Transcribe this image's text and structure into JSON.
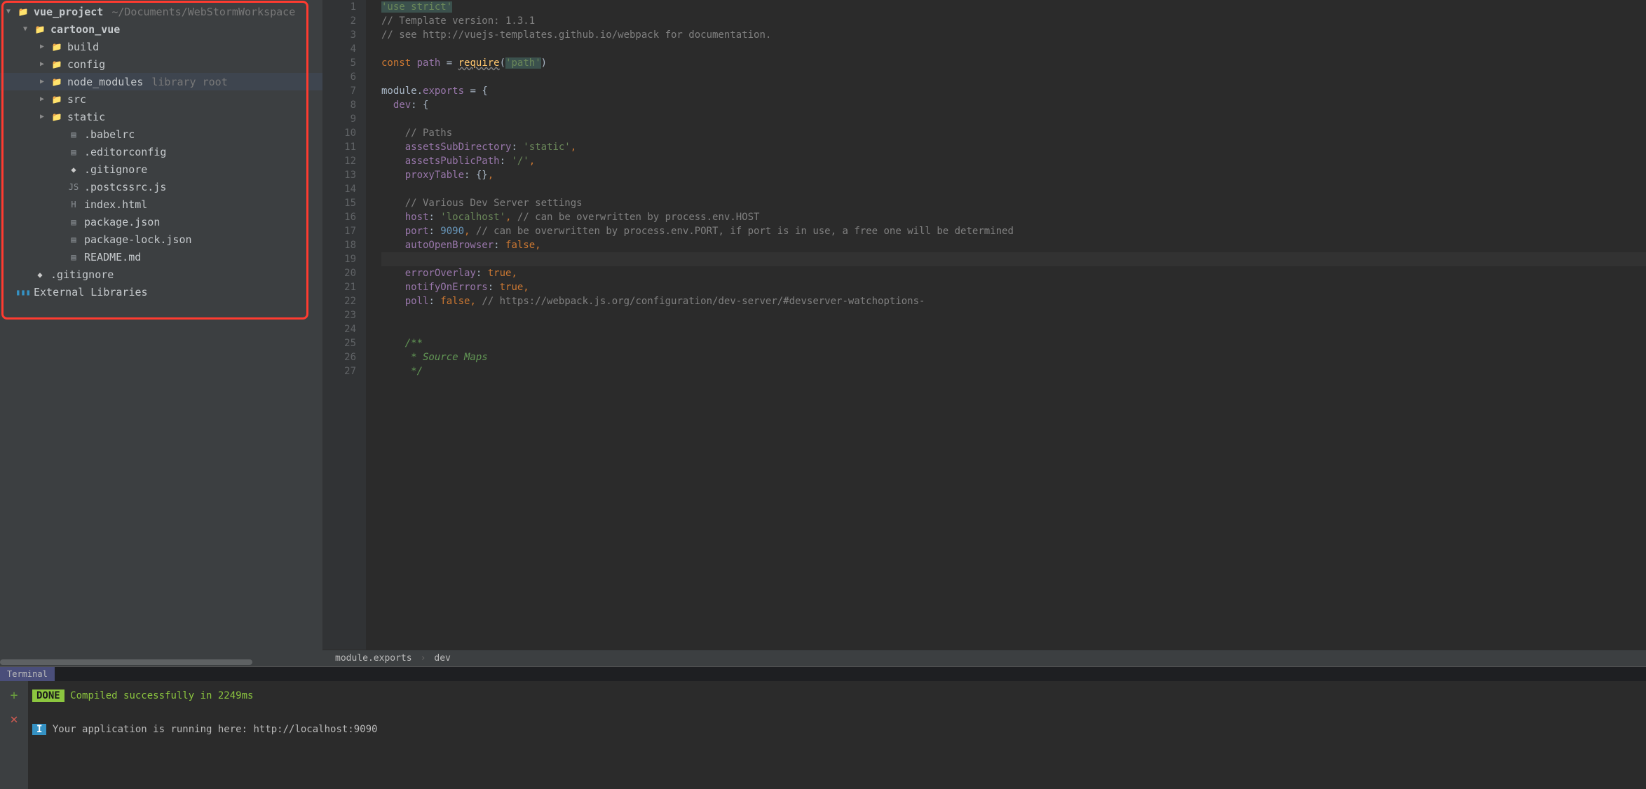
{
  "project": {
    "root_name": "vue_project",
    "root_path": "~/Documents/WebStormWorkspace",
    "tree": [
      {
        "depth": 0,
        "arrow": "down",
        "icon": "folder",
        "label": "vue_project",
        "extra": "~/Documents/WebStormWorkspace",
        "bold": true
      },
      {
        "depth": 1,
        "arrow": "down",
        "icon": "folder",
        "label": "cartoon_vue",
        "bold": true
      },
      {
        "depth": 2,
        "arrow": "right",
        "icon": "folder",
        "label": "build"
      },
      {
        "depth": 2,
        "arrow": "right",
        "icon": "folder",
        "label": "config"
      },
      {
        "depth": 2,
        "arrow": "right",
        "icon": "folder",
        "label": "node_modules",
        "extra": "library root",
        "sel": true
      },
      {
        "depth": 2,
        "arrow": "right",
        "icon": "folder",
        "label": "src"
      },
      {
        "depth": 2,
        "arrow": "right",
        "icon": "folder",
        "label": "static"
      },
      {
        "depth": 3,
        "arrow": "none",
        "icon": "file",
        "label": ".babelrc"
      },
      {
        "depth": 3,
        "arrow": "none",
        "icon": "file",
        "label": ".editorconfig"
      },
      {
        "depth": 3,
        "arrow": "none",
        "icon": "git",
        "label": ".gitignore"
      },
      {
        "depth": 3,
        "arrow": "none",
        "icon": "js",
        "label": ".postcssrc.js"
      },
      {
        "depth": 3,
        "arrow": "none",
        "icon": "html",
        "label": "index.html"
      },
      {
        "depth": 3,
        "arrow": "none",
        "icon": "file",
        "label": "package.json"
      },
      {
        "depth": 3,
        "arrow": "none",
        "icon": "file",
        "label": "package-lock.json"
      },
      {
        "depth": 3,
        "arrow": "none",
        "icon": "file",
        "label": "README.md"
      },
      {
        "depth": 1,
        "arrow": "none",
        "icon": "git",
        "label": ".gitignore"
      },
      {
        "depth": 0,
        "arrow": "none",
        "icon": "libs",
        "label": "External Libraries"
      }
    ]
  },
  "editor": {
    "breadcrumb": [
      "module.exports",
      "dev"
    ],
    "lines": [
      {
        "n": 1,
        "html": "<span class='hl'><span class='str'>'use strict'</span></span>"
      },
      {
        "n": 2,
        "html": "<span class='com'>// Template version: 1.3.1</span>"
      },
      {
        "n": 3,
        "html": "<span class='com'>// see http://vuejs-templates.github.io/webpack for documentation.</span>"
      },
      {
        "n": 4,
        "html": ""
      },
      {
        "n": 5,
        "html": "<span class='kw'>const</span> <span class='prop'>path</span> = <span class='fn underline'>require</span>(<span class='hl'><span class='str'>'path'</span></span>)"
      },
      {
        "n": 6,
        "html": ""
      },
      {
        "n": 7,
        "html": "module.<span class='prop'>exports</span> = {"
      },
      {
        "n": 8,
        "html": "  <span class='prop'>dev</span>: {"
      },
      {
        "n": 9,
        "html": ""
      },
      {
        "n": 10,
        "html": "    <span class='com'>// Paths</span>"
      },
      {
        "n": 11,
        "html": "    <span class='prop'>assetsSubDirectory</span>: <span class='str'>'static'</span><span class='kw'>,</span>"
      },
      {
        "n": 12,
        "html": "    <span class='prop'>assetsPublicPath</span>: <span class='str'>'/'</span><span class='kw'>,</span>"
      },
      {
        "n": 13,
        "html": "    <span class='prop'>proxyTable</span>: {}<span class='kw'>,</span>"
      },
      {
        "n": 14,
        "html": ""
      },
      {
        "n": 15,
        "html": "    <span class='com'>// Various Dev Server settings</span>"
      },
      {
        "n": 16,
        "html": "    <span class='prop'>host</span>: <span class='str'>'localhost'</span><span class='kw'>,</span> <span class='com'>// can be overwritten by process.env.HOST</span>"
      },
      {
        "n": 17,
        "html": "    <span class='prop'>port</span>: <span class='num'>9090</span><span class='kw'>,</span> <span class='com'>// can be overwritten by process.env.PORT, if port is in use, a free one will be determined</span>"
      },
      {
        "n": 18,
        "html": "    <span class='prop'>autoOpenBrowser</span>: <span class='bool'>false,</span>"
      },
      {
        "n": 19,
        "html": "",
        "current": true
      },
      {
        "n": 20,
        "html": "    <span class='prop'>errorOverlay</span>: <span class='bool'>true,</span>"
      },
      {
        "n": 21,
        "html": "    <span class='prop'>notifyOnErrors</span>: <span class='bool'>true,</span>"
      },
      {
        "n": 22,
        "html": "    <span class='prop'>poll</span>: <span class='bool'>false,</span> <span class='com'>// https://webpack.js.org/configuration/dev-server/#devserver-watchoptions-</span>"
      },
      {
        "n": 23,
        "html": ""
      },
      {
        "n": 24,
        "html": ""
      },
      {
        "n": 25,
        "html": "    <span class='doc'>/**</span>"
      },
      {
        "n": 26,
        "html": "    <span class='doc'> * Source Maps</span>"
      },
      {
        "n": 27,
        "html": "    <span class='doc'> */</span>"
      }
    ]
  },
  "terminal": {
    "tab": "Terminal",
    "done_label": "DONE",
    "compile_msg": "Compiled successfully in 2249ms",
    "info_badge": "I",
    "running_msg": "Your application is running here: http://localhost:9090"
  }
}
